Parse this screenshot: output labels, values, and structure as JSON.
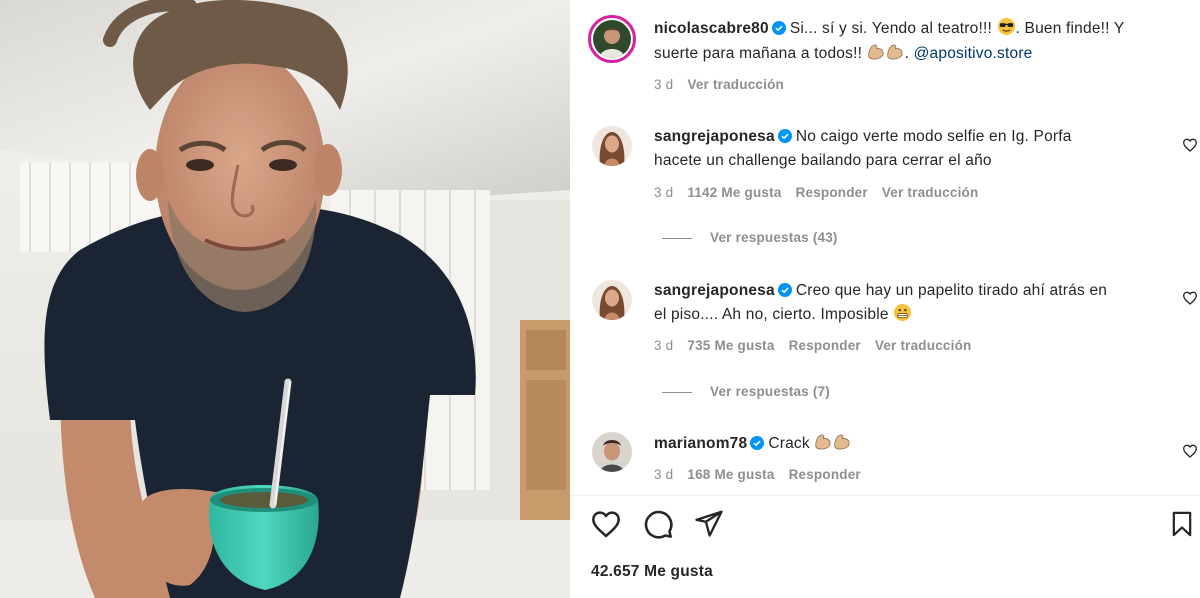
{
  "post": {
    "author": "nicolascabre80",
    "caption_line1": "Si... sí y si. Yendo al teatro!!!",
    "caption_line1b": ". Buen finde!! Y",
    "caption_line2": "suerte para mañana a todos!!",
    "caption_mention": "@apositivo.store",
    "time": "3 d",
    "translate": "Ver traducción",
    "likes": "42.657 Me gusta"
  },
  "comments": [
    {
      "user": "sangrejaponesa",
      "line1": "No caigo verte modo selfie en Ig. Porfa",
      "line2": "hacete un challenge bailando para cerrar el año",
      "time": "3 d",
      "likes": "1142 Me gusta",
      "reply": "Responder",
      "translate": "Ver traducción",
      "replies": "Ver respuestas (43)"
    },
    {
      "user": "sangrejaponesa",
      "line1": "Creo que hay un papelito tirado ahí atrás en",
      "line2": "el piso.... Ah no, cierto. Imposible",
      "time": "3 d",
      "likes": "735 Me gusta",
      "reply": "Responder",
      "translate": "Ver traducción",
      "replies": "Ver respuestas (7)"
    },
    {
      "user": "marianom78",
      "line1": "Crack",
      "time": "3 d",
      "likes": "168 Me gusta",
      "reply": "Responder"
    }
  ],
  "icons": {
    "like": "heart-icon",
    "comment": "comment-icon",
    "share": "share-icon",
    "save": "bookmark-icon"
  },
  "colors": {
    "verified": "#0095f6",
    "story_ring": "#d6249f",
    "mate_cup": "#3ec9b0",
    "shirt": "#1b2432"
  }
}
